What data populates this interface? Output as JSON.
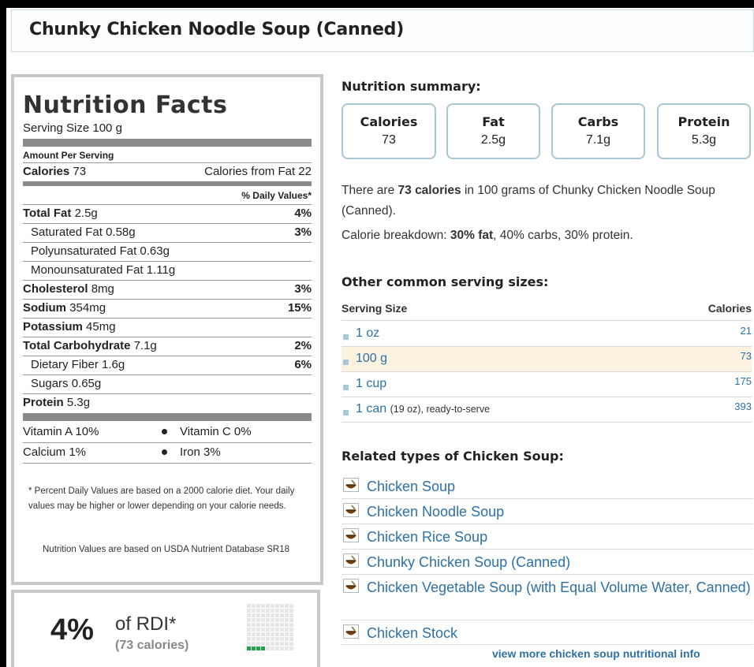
{
  "page": {
    "title": "Chunky Chicken Noodle Soup (Canned)"
  },
  "label": {
    "heading": "Nutrition Facts",
    "serving_size": "Serving Size 100 g",
    "amount_per_serving": "Amount Per Serving",
    "calories_label": "Calories",
    "calories_value": "73",
    "calories_from_fat": "Calories from Fat 22",
    "daily_values_header": "% Daily Values*",
    "rows": {
      "total_fat": {
        "name": "Total Fat",
        "amount": "2.5g",
        "dv": "4%"
      },
      "saturated_fat": {
        "name": "Saturated Fat",
        "amount": "0.58g",
        "dv": "3%"
      },
      "polyunsaturated_fat": {
        "name": "Polyunsaturated Fat",
        "amount": "0.63g"
      },
      "monounsaturated_fat": {
        "name": "Monounsaturated Fat",
        "amount": "1.11g"
      },
      "cholesterol": {
        "name": "Cholesterol",
        "amount": "8mg",
        "dv": "3%"
      },
      "sodium": {
        "name": "Sodium",
        "amount": "354mg",
        "dv": "15%"
      },
      "potassium": {
        "name": "Potassium",
        "amount": "45mg"
      },
      "total_carbohydrate": {
        "name": "Total Carbohydrate",
        "amount": "7.1g",
        "dv": "2%"
      },
      "dietary_fiber": {
        "name": "Dietary Fiber",
        "amount": "1.6g",
        "dv": "6%"
      },
      "sugars": {
        "name": "Sugars",
        "amount": "0.65g"
      },
      "protein": {
        "name": "Protein",
        "amount": "5.3g"
      }
    },
    "vitamin_a": "Vitamin A 10%",
    "vitamin_c": "Vitamin C 0%",
    "calcium": "Calcium 1%",
    "iron": "Iron 3%",
    "footnote": "* Percent Daily Values are based on a 2000 calorie diet. Your daily values may be higher or lower depending on your calorie needs.",
    "usda_note": "Nutrition Values are based on USDA Nutrient Database SR18"
  },
  "rdi": {
    "percent": "4%",
    "of_text": "of RDI*",
    "calories_text": "(73 calories)",
    "grid_fraction": 0.04,
    "grid_on_color": "#1ea24a"
  },
  "summary": {
    "heading": "Nutrition summary:",
    "cards": [
      {
        "label": "Calories",
        "value": "73"
      },
      {
        "label": "Fat",
        "value": "2.5g"
      },
      {
        "label": "Carbs",
        "value": "7.1g"
      },
      {
        "label": "Protein",
        "value": "5.3g"
      }
    ],
    "sentence_pre": "There are",
    "sentence_bold": "73 calories",
    "sentence_post": "in 100 grams of Chunky Chicken Noodle Soup (Canned).",
    "breakdown_pre": "Calorie breakdown:",
    "breakdown_fat": "30% fat",
    "breakdown_rest": ", 40% carbs, 30% protein."
  },
  "servings": {
    "heading": "Other common serving sizes:",
    "col_size": "Serving Size",
    "col_calories": "Calories",
    "rows": [
      {
        "size": "1 oz",
        "extra": "",
        "calories": "21"
      },
      {
        "size": "100 g",
        "extra": "",
        "calories": "73"
      },
      {
        "size": "1 cup",
        "extra": "",
        "calories": "175"
      },
      {
        "size": "1 can",
        "extra": "(19 oz), ready-to-serve",
        "calories": "393"
      }
    ]
  },
  "related": {
    "heading": "Related types of Chicken Soup:",
    "items": [
      "Chicken Soup",
      "Chicken Noodle Soup",
      "Chicken Rice Soup",
      "Chunky Chicken Soup (Canned)",
      "Chicken Vegetable Soup (with Equal Volume Water, Canned)",
      "Chicken Stock"
    ],
    "icon": "soup-bowl-icon",
    "more_link": "view more chicken soup nutritional info"
  },
  "colors": {
    "link": "#2d71a6",
    "card_border": "#aac6d3",
    "highlight_row": "#fbf2df"
  }
}
